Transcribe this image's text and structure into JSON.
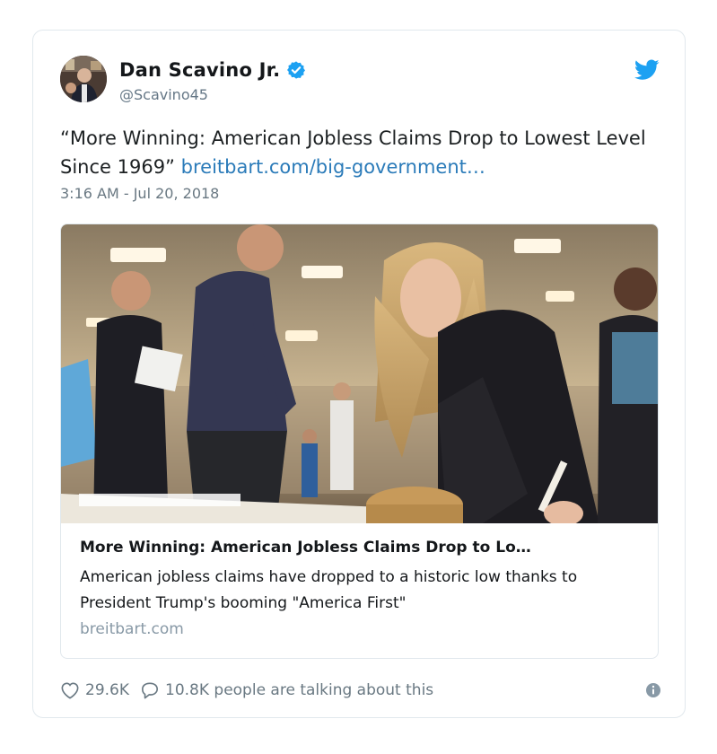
{
  "author": {
    "name": "Dan Scavino Jr.",
    "handle": "@Scavino45",
    "verified": true
  },
  "tweet": {
    "text": "“More Winning: American Jobless Claims Drop to Lowest Level Since 1969”",
    "link_text": "breitbart.com/big-government…",
    "timestamp": "3:16 AM - Jul 20, 2018"
  },
  "card": {
    "title": "More Winning: American Jobless Claims Drop to Lo…",
    "description": "American jobless claims have dropped to a historic low thanks to President Trump's booming \"America First\"",
    "domain": "breitbart.com"
  },
  "footer": {
    "likes": "29.6K",
    "replies": "10.8K people are talking about this"
  },
  "icons": {
    "verified": "verified-badge-icon",
    "bird": "twitter-bird-icon",
    "like": "heart-icon",
    "reply": "speech-bubble-icon",
    "info": "info-icon"
  },
  "colors": {
    "link": "#2b7bb9",
    "twitter_blue": "#1da1f2",
    "muted": "#697882",
    "border": "#e1e8ed"
  }
}
